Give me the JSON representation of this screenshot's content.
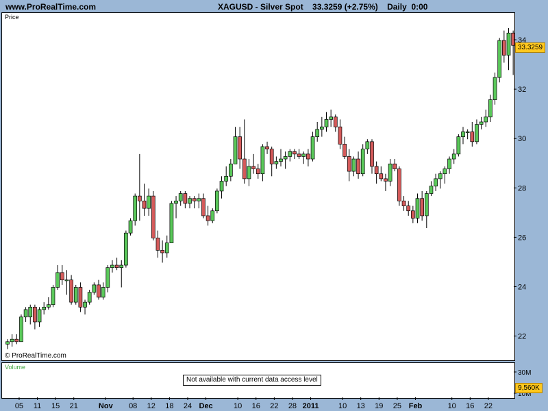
{
  "header": {
    "site": "www.ProRealTime.com",
    "title": "XAGUSD - Silver Spot    33.3259 (+2.75%)    Daily  0:00"
  },
  "price_panel": {
    "label": "Price",
    "copyright": "© ProRealTime.com",
    "last_price": "33.3259"
  },
  "volume_panel": {
    "label": "Volume",
    "message": "Not available with current data access level",
    "last_value": "9,560K",
    "axis_labels": [
      "30M",
      "10M"
    ]
  },
  "colors": {
    "up": "#5ac85a",
    "down": "#d45a5a",
    "wick": "#000000",
    "background": "#9bb7d6",
    "highlight": "#ffc81e"
  },
  "chart_data": {
    "type": "candlestick",
    "title": "XAGUSD - Silver Spot",
    "y_ticks": [
      22,
      24,
      26,
      28,
      30,
      32,
      34
    ],
    "ylim": [
      21.6,
      35.0
    ],
    "x_ticks": [
      {
        "label": "05",
        "bold": false
      },
      {
        "label": "11",
        "bold": false
      },
      {
        "label": "15",
        "bold": false
      },
      {
        "label": "21",
        "bold": false
      },
      {
        "label": "Nov",
        "bold": true
      },
      {
        "label": "08",
        "bold": false
      },
      {
        "label": "12",
        "bold": false
      },
      {
        "label": "18",
        "bold": false
      },
      {
        "label": "24",
        "bold": false
      },
      {
        "label": "Dec",
        "bold": true
      },
      {
        "label": "10",
        "bold": false
      },
      {
        "label": "16",
        "bold": false
      },
      {
        "label": "22",
        "bold": false
      },
      {
        "label": "28",
        "bold": false
      },
      {
        "label": "2011",
        "bold": true
      },
      {
        "label": "10",
        "bold": false
      },
      {
        "label": "13",
        "bold": false
      },
      {
        "label": "19",
        "bold": false
      },
      {
        "label": "25",
        "bold": false
      },
      {
        "label": "Feb",
        "bold": true
      },
      {
        "label": "10",
        "bold": false
      },
      {
        "label": "16",
        "bold": false
      },
      {
        "label": "22",
        "bold": false
      }
    ],
    "x_tick_index": [
      3,
      7,
      11,
      15,
      22,
      28,
      32,
      36,
      40,
      44,
      51,
      55,
      59,
      63,
      67,
      74,
      78,
      82,
      86,
      90,
      98,
      102,
      106
    ],
    "candles": [
      [
        21.7,
        21.9,
        21.5,
        21.8
      ],
      [
        21.8,
        22.1,
        21.6,
        21.9
      ],
      [
        21.9,
        22.1,
        21.7,
        21.8
      ],
      [
        21.8,
        22.9,
        21.8,
        22.8
      ],
      [
        22.8,
        23.2,
        22.6,
        23.1
      ],
      [
        22.8,
        23.3,
        22.5,
        23.2
      ],
      [
        23.2,
        23.3,
        22.3,
        22.6
      ],
      [
        22.6,
        23.2,
        22.4,
        23.1
      ],
      [
        23.1,
        23.4,
        22.9,
        23.2
      ],
      [
        23.2,
        23.6,
        23.1,
        23.3
      ],
      [
        23.3,
        24.1,
        23.2,
        24.0
      ],
      [
        24.0,
        24.9,
        23.9,
        24.6
      ],
      [
        24.6,
        24.9,
        24.1,
        24.3
      ],
      [
        24.3,
        24.7,
        23.7,
        24.3
      ],
      [
        24.3,
        24.5,
        23.3,
        23.4
      ],
      [
        23.4,
        24.1,
        23.3,
        24.0
      ],
      [
        24.0,
        24.2,
        23.0,
        23.2
      ],
      [
        23.2,
        23.5,
        22.9,
        23.4
      ],
      [
        23.4,
        23.9,
        23.3,
        23.8
      ],
      [
        23.8,
        24.2,
        23.7,
        24.1
      ],
      [
        24.1,
        24.3,
        23.5,
        23.6
      ],
      [
        23.6,
        24.2,
        23.5,
        24.0
      ],
      [
        24.0,
        24.9,
        23.8,
        24.8
      ],
      [
        24.8,
        25.1,
        24.6,
        24.9
      ],
      [
        24.9,
        25.2,
        24.7,
        24.8
      ],
      [
        24.8,
        25.1,
        24.0,
        24.9
      ],
      [
        24.9,
        26.3,
        24.8,
        26.2
      ],
      [
        26.2,
        26.8,
        26.1,
        26.7
      ],
      [
        26.7,
        27.8,
        26.5,
        27.7
      ],
      [
        27.7,
        29.4,
        26.7,
        27.5
      ],
      [
        27.5,
        28.2,
        26.9,
        27.2
      ],
      [
        27.2,
        28.0,
        26.9,
        27.7
      ],
      [
        27.7,
        27.9,
        25.9,
        26.0
      ],
      [
        26.0,
        26.3,
        25.2,
        25.5
      ],
      [
        25.5,
        25.9,
        25.0,
        25.4
      ],
      [
        25.4,
        26.1,
        25.2,
        25.8
      ],
      [
        25.8,
        27.5,
        25.8,
        27.4
      ],
      [
        27.4,
        27.7,
        26.8,
        27.5
      ],
      [
        27.5,
        27.9,
        27.3,
        27.8
      ],
      [
        27.8,
        27.9,
        27.2,
        27.4
      ],
      [
        27.4,
        27.7,
        27.2,
        27.6
      ],
      [
        27.6,
        27.7,
        27.2,
        27.5
      ],
      [
        27.5,
        27.8,
        27.2,
        27.6
      ],
      [
        27.6,
        27.8,
        26.8,
        26.9
      ],
      [
        26.9,
        27.3,
        26.5,
        26.7
      ],
      [
        26.7,
        27.2,
        26.6,
        27.1
      ],
      [
        27.1,
        28.0,
        27.0,
        27.9
      ],
      [
        27.9,
        28.5,
        27.6,
        28.3
      ],
      [
        28.3,
        28.9,
        28.1,
        28.5
      ],
      [
        28.5,
        29.2,
        28.3,
        29.0
      ],
      [
        29.0,
        30.5,
        29.0,
        30.1
      ],
      [
        30.1,
        30.5,
        28.8,
        29.2
      ],
      [
        29.2,
        30.8,
        28.2,
        28.4
      ],
      [
        28.4,
        29.2,
        28.1,
        28.9
      ],
      [
        28.9,
        29.4,
        28.6,
        28.8
      ],
      [
        28.8,
        29.0,
        28.4,
        28.6
      ],
      [
        28.6,
        29.8,
        28.3,
        29.7
      ],
      [
        29.7,
        29.9,
        29.4,
        29.6
      ],
      [
        29.6,
        29.7,
        28.5,
        29.0
      ],
      [
        29.0,
        29.3,
        28.8,
        29.1
      ],
      [
        29.1,
        29.6,
        28.9,
        29.2
      ],
      [
        29.2,
        29.5,
        28.8,
        29.3
      ],
      [
        29.3,
        29.6,
        29.1,
        29.5
      ],
      [
        29.5,
        29.6,
        29.2,
        29.4
      ],
      [
        29.4,
        29.6,
        29.2,
        29.3
      ],
      [
        29.3,
        29.5,
        29.0,
        29.4
      ],
      [
        29.4,
        29.6,
        28.9,
        29.2
      ],
      [
        29.2,
        30.3,
        29.1,
        30.1
      ],
      [
        30.1,
        30.7,
        29.9,
        30.4
      ],
      [
        30.4,
        30.9,
        30.1,
        30.5
      ],
      [
        30.5,
        31.1,
        30.3,
        30.8
      ],
      [
        30.8,
        31.2,
        30.5,
        30.9
      ],
      [
        30.9,
        31.0,
        30.3,
        30.5
      ],
      [
        30.5,
        30.8,
        29.6,
        29.8
      ],
      [
        29.8,
        30.1,
        29.2,
        29.3
      ],
      [
        29.3,
        29.6,
        28.3,
        28.7
      ],
      [
        28.7,
        29.3,
        28.5,
        29.2
      ],
      [
        29.2,
        29.5,
        28.4,
        28.6
      ],
      [
        28.6,
        29.8,
        28.5,
        29.6
      ],
      [
        29.6,
        30.0,
        29.4,
        29.9
      ],
      [
        29.9,
        30.0,
        28.6,
        28.9
      ],
      [
        28.9,
        29.1,
        28.2,
        28.6
      ],
      [
        28.6,
        28.9,
        28.3,
        28.4
      ],
      [
        28.4,
        28.6,
        27.9,
        28.3
      ],
      [
        28.3,
        29.2,
        28.1,
        29.0
      ],
      [
        29.0,
        29.2,
        28.7,
        28.8
      ],
      [
        28.8,
        28.9,
        27.3,
        27.5
      ],
      [
        27.5,
        27.7,
        27.1,
        27.3
      ],
      [
        27.3,
        27.5,
        26.9,
        27.1
      ],
      [
        27.1,
        27.3,
        26.6,
        26.8
      ],
      [
        26.8,
        27.8,
        26.6,
        27.6
      ],
      [
        27.6,
        27.9,
        26.7,
        26.9
      ],
      [
        26.9,
        27.9,
        26.4,
        27.8
      ],
      [
        27.8,
        28.3,
        27.7,
        28.1
      ],
      [
        28.1,
        28.6,
        27.9,
        28.4
      ],
      [
        28.4,
        28.7,
        28.0,
        28.6
      ],
      [
        28.6,
        28.9,
        28.2,
        28.8
      ],
      [
        28.8,
        29.3,
        28.6,
        29.2
      ],
      [
        29.2,
        29.6,
        29.0,
        29.4
      ],
      [
        29.4,
        30.2,
        29.3,
        30.1
      ],
      [
        30.1,
        30.5,
        29.8,
        30.3
      ],
      [
        30.3,
        30.4,
        30.0,
        30.3
      ],
      [
        30.3,
        30.7,
        29.7,
        29.9
      ],
      [
        29.9,
        30.8,
        29.8,
        30.6
      ],
      [
        30.6,
        30.9,
        30.4,
        30.7
      ],
      [
        30.7,
        31.2,
        30.5,
        30.9
      ],
      [
        30.9,
        31.8,
        30.7,
        31.6
      ],
      [
        31.6,
        32.7,
        31.4,
        32.5
      ],
      [
        32.5,
        34.1,
        32.3,
        34.0
      ],
      [
        34.0,
        34.4,
        33.1,
        33.4
      ],
      [
        33.4,
        34.5,
        32.8,
        34.3
      ],
      [
        34.3,
        34.4,
        32.6,
        33.8
      ],
      [
        33.8,
        33.9,
        32.4,
        32.6
      ],
      [
        32.6,
        33.2,
        32.4,
        33.3
      ]
    ]
  }
}
